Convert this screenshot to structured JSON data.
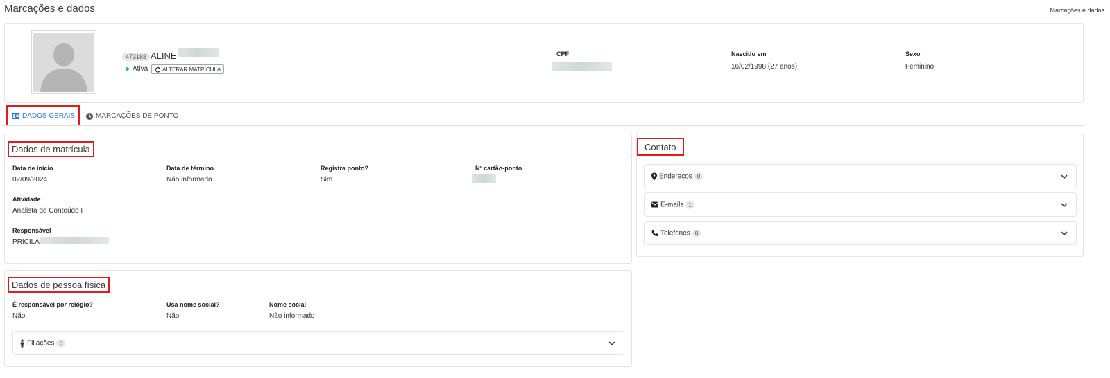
{
  "page": {
    "title": "Marcações e dados",
    "breadcrumb": "Marcações e dados"
  },
  "profile": {
    "id": "473188",
    "name": "ALINE",
    "status": "Ativa",
    "alter_button": "ALTERAR MATRÍCULA",
    "cpf_label": "CPF",
    "birth_label": "Nascido em",
    "birth_value": "16/02/1998 (27 anos)",
    "sex_label": "Sexo",
    "sex_value": "Feminino",
    "status_color": "#2dbf7b"
  },
  "tabs": [
    {
      "label": "DADOS GERAIS",
      "icon": "id-card-icon",
      "active": true
    },
    {
      "label": "MARCAÇÕES DE PONTO",
      "icon": "clock-icon",
      "active": false
    }
  ],
  "matricula": {
    "title": "Dados de matrícula",
    "fields": [
      {
        "label": "Data de início",
        "value": "02/09/2024"
      },
      {
        "label": "Data de término",
        "value": "Não informado"
      },
      {
        "label": "Registra ponto?",
        "value": "Sim"
      },
      {
        "label": "Nº cartão-ponto",
        "value": ""
      },
      {
        "label": "Atividade",
        "value": "Analista de Conteúdo I"
      },
      {
        "label": "Responsável",
        "value": "PRICILA"
      }
    ]
  },
  "pessoa": {
    "title": "Dados de pessoa física",
    "fields": [
      {
        "label": "É responsável por relógio?",
        "value": "Não"
      },
      {
        "label": "Usa nome social?",
        "value": "Não"
      },
      {
        "label": "Nome social",
        "value": "Não informado"
      }
    ],
    "filiacoes": {
      "label": "Filiações",
      "count": "0"
    }
  },
  "contato": {
    "title": "Contato",
    "items": [
      {
        "label": "Endereços",
        "count": "0",
        "icon": "map-marker-icon"
      },
      {
        "label": "E-mails",
        "count": "1",
        "icon": "envelope-icon"
      },
      {
        "label": "Telefones",
        "count": "0",
        "icon": "phone-icon"
      }
    ]
  },
  "colors": {
    "accent": "#2a7bd6",
    "highlight": "#e21c1c"
  }
}
